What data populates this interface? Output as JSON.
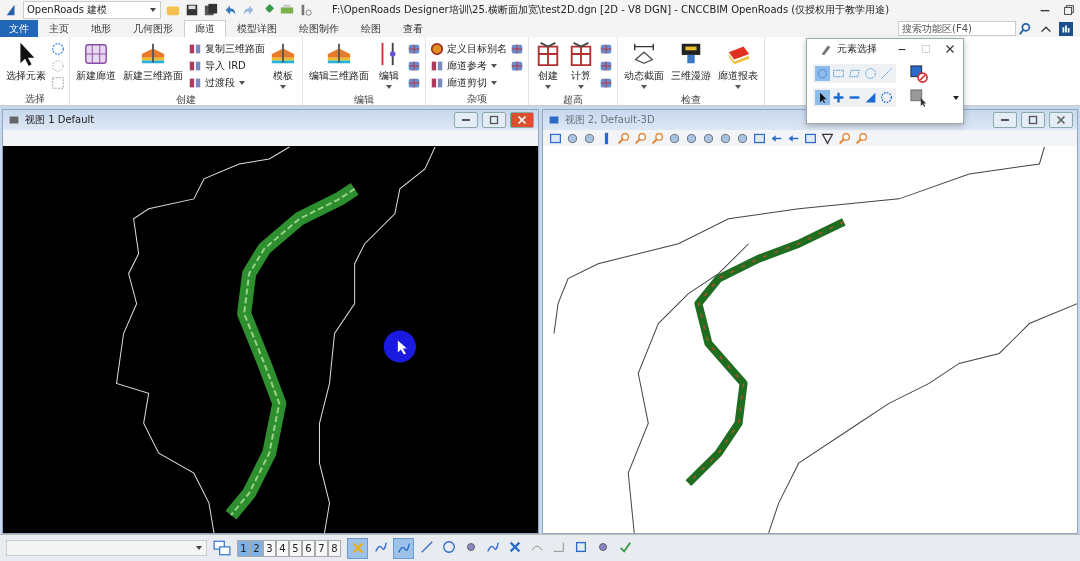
{
  "title_bar": {
    "workspace": "OpenRoads 建模",
    "title": "F:\\OpenRoads Designer培训\\25.横断面加宽\\test2D.dgn [2D - V8 DGN] - CNCCBIM OpenRoads (仅授权用于教学用途)"
  },
  "tabs": [
    {
      "label": "文件",
      "kind": "file",
      "selected": false
    },
    {
      "label": "主页",
      "kind": "tab",
      "selected": false
    },
    {
      "label": "地形",
      "kind": "tab",
      "selected": false
    },
    {
      "label": "几何图形",
      "kind": "tab",
      "selected": false
    },
    {
      "label": "廊道",
      "kind": "tab",
      "selected": true
    },
    {
      "label": "模型详图",
      "kind": "tab",
      "selected": false
    },
    {
      "label": "绘图制作",
      "kind": "tab",
      "selected": false
    },
    {
      "label": "绘图",
      "kind": "tab",
      "selected": false
    },
    {
      "label": "查看",
      "kind": "tab",
      "selected": false
    }
  ],
  "search": {
    "placeholder": "搜索功能区(F4)"
  },
  "ribbon_groups": [
    {
      "label": "选择",
      "buttons": [
        {
          "kind": "large",
          "label": "选择元素",
          "dropdown": false
        },
        {
          "kind": "icons"
        }
      ]
    },
    {
      "label": "创建",
      "buttons": [
        {
          "kind": "large",
          "label": "新建廊道",
          "dropdown": false
        },
        {
          "kind": "large",
          "label": "新建三维路面",
          "dropdown": false
        },
        {
          "kind": "small",
          "items": [
            {
              "label": "复制三维路面",
              "dropdown": false
            },
            {
              "label": "导入 IRD",
              "dropdown": false
            },
            {
              "label": "过渡段",
              "dropdown": true
            }
          ]
        },
        {
          "kind": "large",
          "label": "模板",
          "dropdown": true
        }
      ]
    },
    {
      "label": "编辑",
      "buttons": [
        {
          "kind": "large",
          "label": "编辑三维路面",
          "dropdown": false
        },
        {
          "kind": "large",
          "label": "编辑",
          "dropdown": true
        },
        {
          "kind": "icons"
        }
      ]
    },
    {
      "label": "杂项",
      "buttons": [
        {
          "kind": "small",
          "items": [
            {
              "label": "定义目标别名",
              "dropdown": false
            },
            {
              "label": "廊道参考",
              "dropdown": true
            },
            {
              "label": "廊道剪切",
              "dropdown": true
            }
          ]
        },
        {
          "kind": "icons"
        }
      ]
    },
    {
      "label": "超高",
      "buttons": [
        {
          "kind": "large",
          "label": "创建",
          "dropdown": true
        },
        {
          "kind": "large",
          "label": "计算",
          "dropdown": true
        },
        {
          "kind": "icons"
        }
      ]
    },
    {
      "label": "检查",
      "buttons": [
        {
          "kind": "large",
          "label": "动态截面",
          "dropdown": true
        },
        {
          "kind": "large",
          "label": "三维漫游",
          "dropdown": false
        },
        {
          "kind": "large",
          "label": "廊道报表",
          "dropdown": true
        }
      ]
    }
  ],
  "views": [
    {
      "title": "视图 1  Default",
      "active": true,
      "toolbar": false
    },
    {
      "title": "视图 2, Default-3D",
      "active": false,
      "toolbar": true
    }
  ],
  "element_selection": {
    "title": "元素选择",
    "methods": [
      {
        "selected": true
      },
      {
        "selected": false
      },
      {
        "selected": false
      },
      {
        "selected": false
      },
      {
        "selected": false
      }
    ],
    "modes": [
      {
        "selected": true
      },
      {
        "selected": false
      },
      {
        "selected": false
      },
      {
        "selected": false
      },
      {
        "selected": false
      }
    ]
  },
  "status_bar": {
    "view_numbers": [
      {
        "label": "1",
        "selected": true
      },
      {
        "label": "2",
        "selected": true
      },
      {
        "label": "3",
        "selected": false
      },
      {
        "label": "4",
        "selected": false
      },
      {
        "label": "5",
        "selected": false
      },
      {
        "label": "6",
        "selected": false
      },
      {
        "label": "7",
        "selected": false
      },
      {
        "label": "8",
        "selected": false
      }
    ],
    "snaps": [
      {
        "selected": true
      },
      {
        "selected": false
      },
      {
        "selected": true
      },
      {
        "selected": false
      },
      {
        "selected": false
      },
      {
        "selected": false
      },
      {
        "selected": false
      },
      {
        "selected": false
      },
      {
        "selected": false
      },
      {
        "selected": false
      },
      {
        "selected": false
      },
      {
        "selected": false
      },
      {
        "selected": false
      }
    ]
  }
}
